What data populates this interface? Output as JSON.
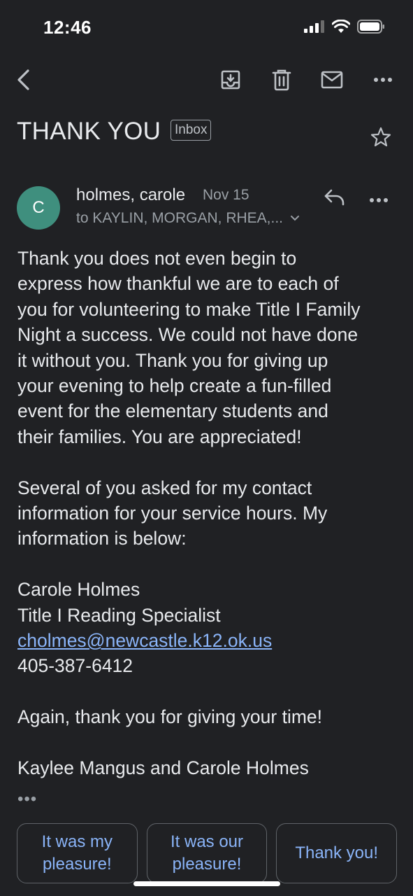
{
  "status_bar": {
    "time": "12:46"
  },
  "toolbar": {
    "icons": [
      "back-arrow-icon",
      "archive-icon",
      "trash-icon",
      "mail-icon",
      "more-icon"
    ]
  },
  "email": {
    "subject": "THANK YOU",
    "label": "Inbox",
    "sender": {
      "initial": "C",
      "name": "holmes, carole",
      "date": "Nov 15",
      "recipients": "to KAYLIN, MORGAN, RHEA,...",
      "avatar_color": "#3f8f7e"
    },
    "body": {
      "para1": [
        "Thank you does not even begin to",
        "express how thankful we are to each of",
        "you for volunteering to make Title I Family",
        "Night a success. We could not have done",
        "it without you. Thank you for giving up",
        "your evening to help create a fun-filled",
        "event for the elementary students and",
        "their families. You are appreciated!"
      ],
      "para2": [
        "Several of you asked for my contact",
        "information for your service hours. My",
        "information is below:"
      ],
      "signature": {
        "name": "Carole Holmes",
        "title": "Title I Reading Specialist",
        "email": "cholmes@newcastle.k12.ok.us",
        "phone": "405-387-6412"
      },
      "para3": "Again, thank you for giving your time!",
      "closing": "Kaylee Mangus and Carole Holmes",
      "trimmed": "•••"
    }
  },
  "smart_replies": [
    {
      "line1": "It was my",
      "line2": "pleasure!"
    },
    {
      "line1": "It was our",
      "line2": "pleasure!"
    },
    {
      "line1": "Thank you!",
      "line2": ""
    }
  ],
  "colors": {
    "background": "#202124",
    "text": "#e8eaed",
    "secondary": "#9aa0a6",
    "link": "#8ab4f8"
  }
}
